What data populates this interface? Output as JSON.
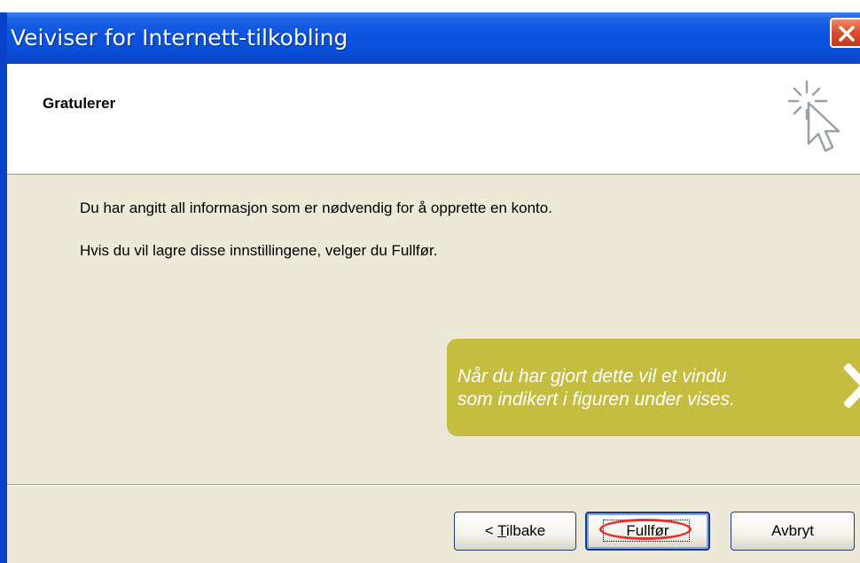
{
  "window": {
    "title": "Veiviser for Internett-tilkobling",
    "close_icon": "close-icon"
  },
  "header": {
    "title": "Gratulerer",
    "icon": "wizard-cursor-icon"
  },
  "content": {
    "line1": "Du har angitt all informasjon som er nødvendig for å opprette en konto.",
    "line2": "Hvis du vil lagre disse innstillingene, velger du Fullfør."
  },
  "callout": {
    "line1": "Når du har gjort dette vil et vindu",
    "line2": "som indikert i figuren under vises.",
    "icon": "chevron-right-icon",
    "color": "#c4bd40"
  },
  "buttons": {
    "back": {
      "prefix": "< ",
      "mnemonic": "T",
      "rest": "ilbake"
    },
    "finish": "Fullfør",
    "cancel": "Avbryt"
  },
  "colors": {
    "titlebar": "#0a53e0",
    "dialog_background": "#ece9d8",
    "highlight_ring": "#e0342a"
  }
}
